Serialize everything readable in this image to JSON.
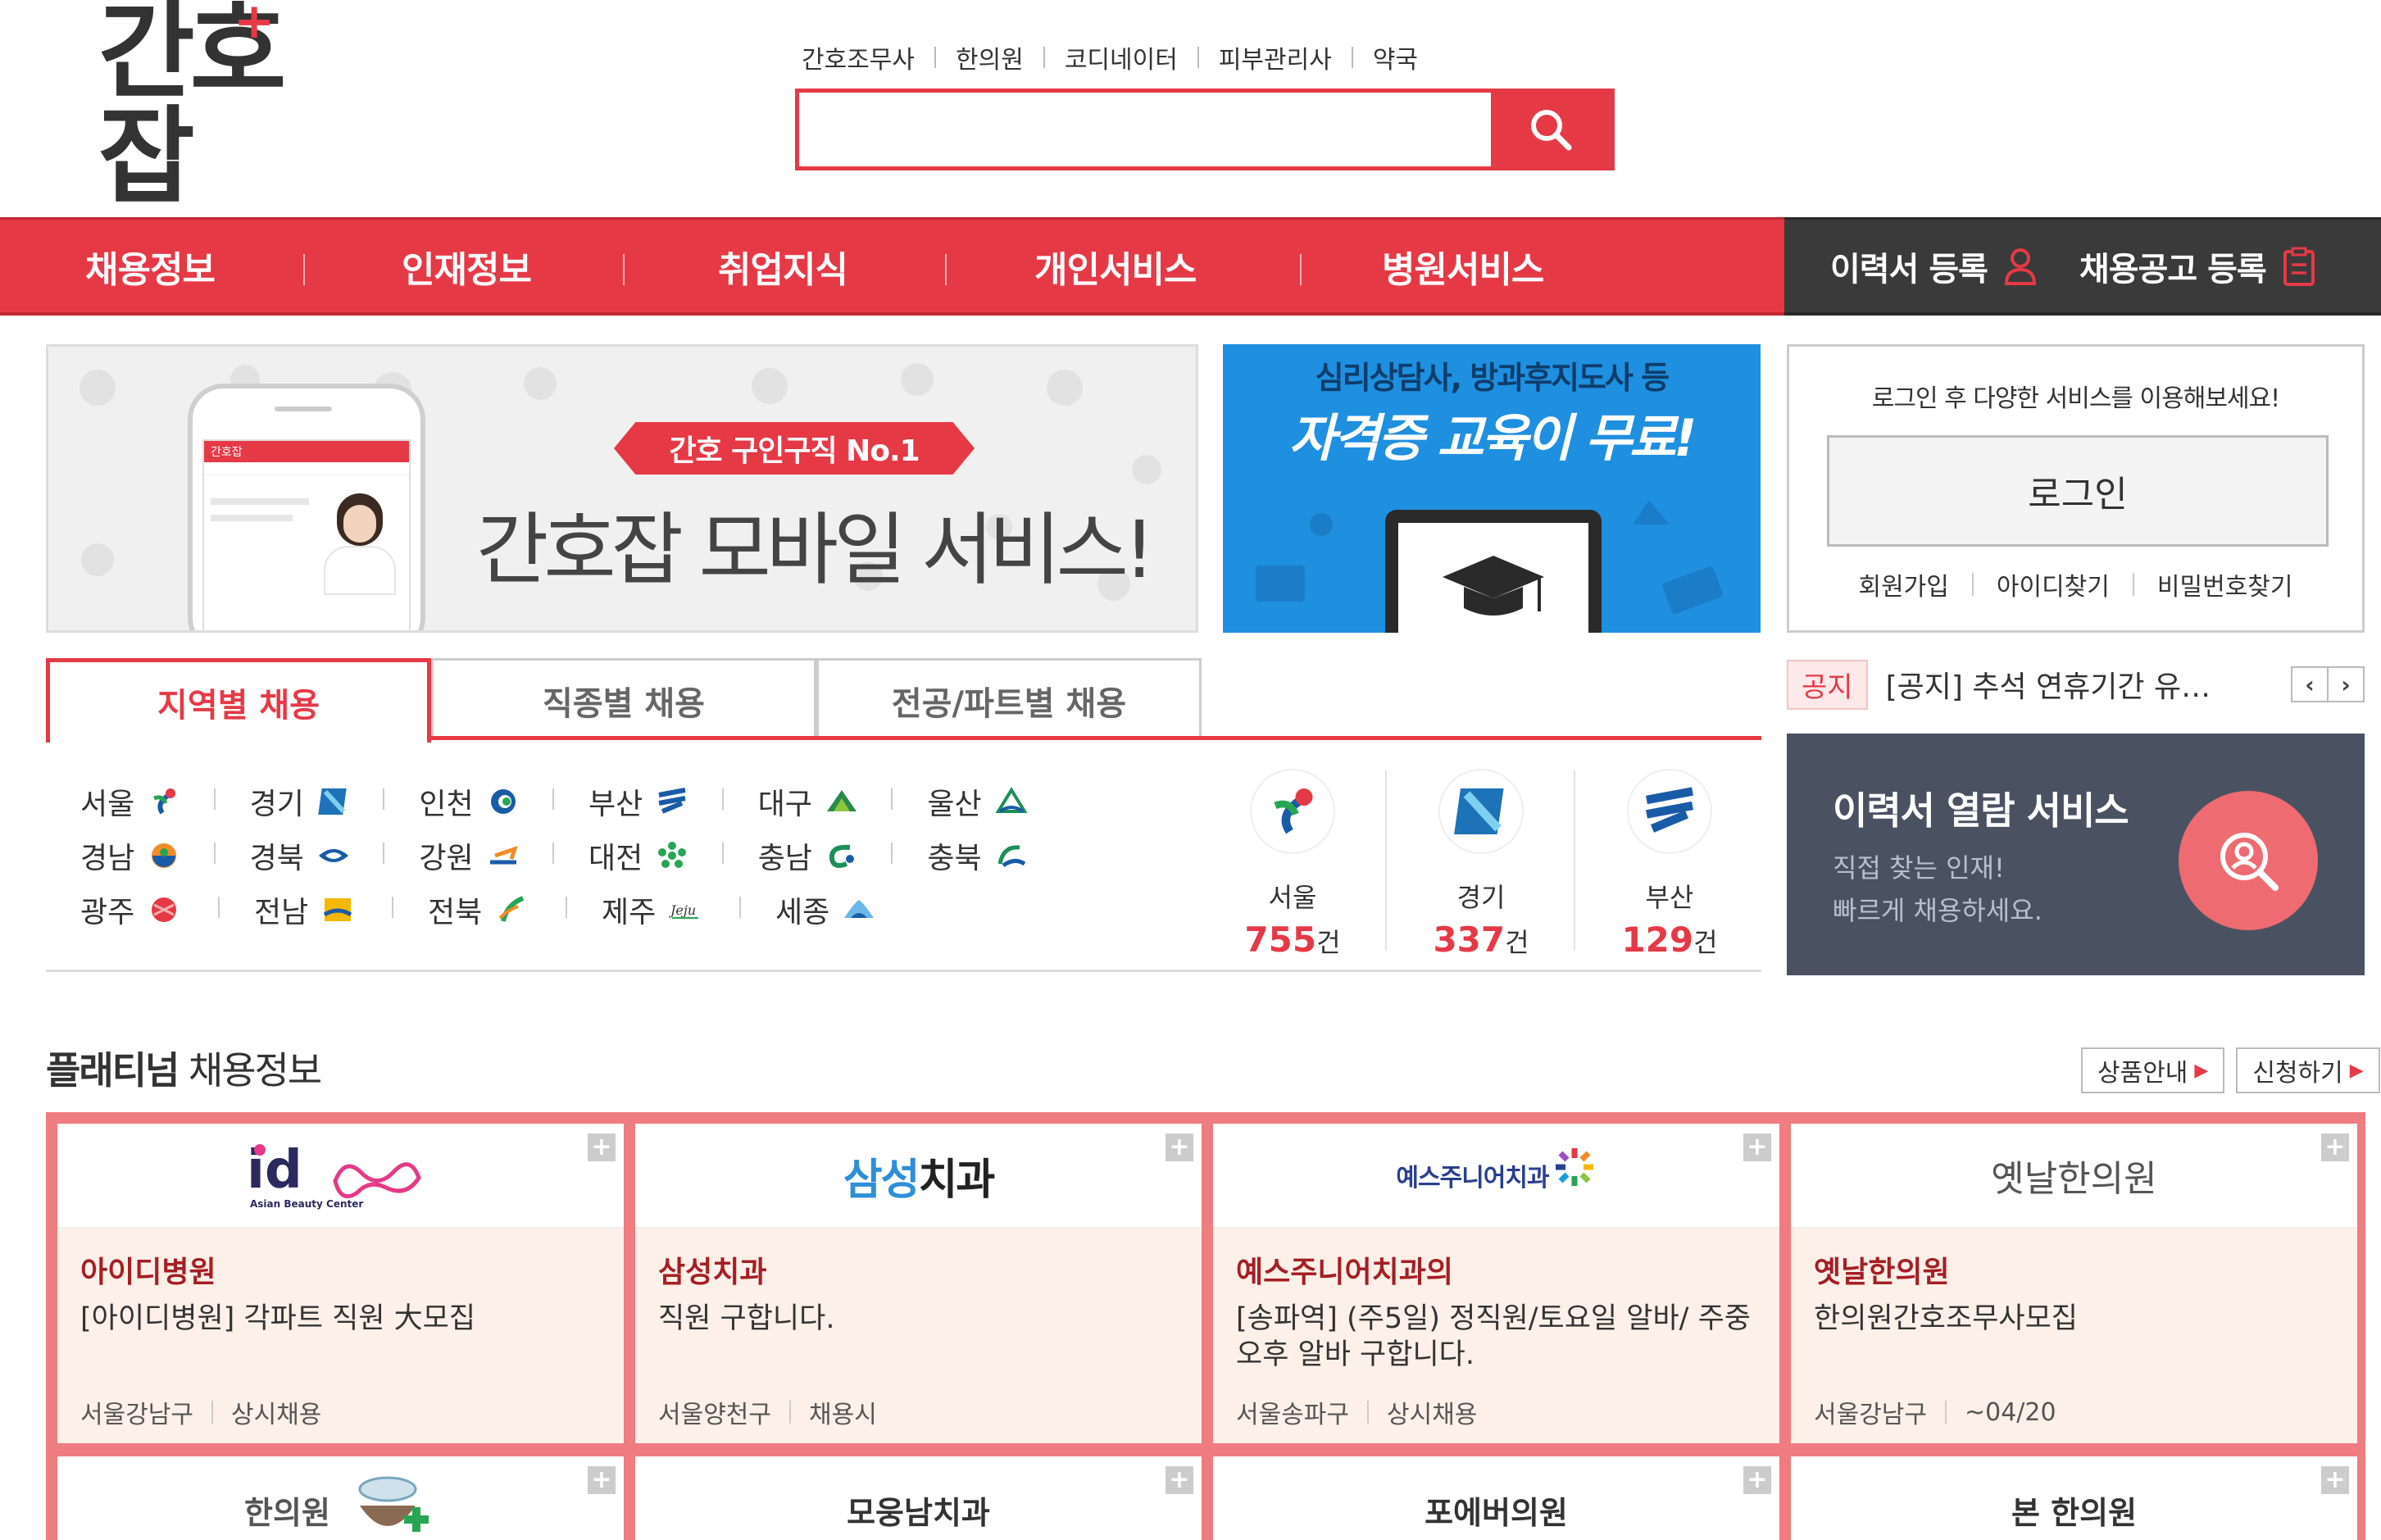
{
  "logo": {
    "text": "간호잡",
    "plus": "+"
  },
  "top_categories": [
    "간호조무사",
    "한의원",
    "코디네이터",
    "피부관리사",
    "약국"
  ],
  "search": {
    "value": "",
    "placeholder": ""
  },
  "nav": {
    "items": [
      "채용정보",
      "인재정보",
      "취업지식",
      "개인서비스",
      "병원서비스"
    ],
    "resume_register": "이력서 등록",
    "job_post_register": "채용공고 등록"
  },
  "banner1": {
    "ribbon": "간호 구인구직 No.1",
    "headline": "간호잡 모바일 서비스!",
    "phone_title": "간호잡"
  },
  "banner2": {
    "line1": "심리상담사, 방과후지도사 등",
    "line2": "자격증 교육이 무료!"
  },
  "login": {
    "message": "로그인 후 다양한 서비스를 이용해보세요!",
    "button": "로그인",
    "links": [
      "회원가입",
      "아이디찾기",
      "비밀번호찾기"
    ]
  },
  "tabs": [
    "지역별 채용",
    "직종별 채용",
    "전공/파트별 채용"
  ],
  "regions": [
    [
      "서울",
      "경기",
      "인천",
      "부산",
      "대구",
      "울산"
    ],
    [
      "경남",
      "경북",
      "강원",
      "대전",
      "충남",
      "충북"
    ],
    [
      "광주",
      "전남",
      "전북",
      "제주",
      "세종"
    ]
  ],
  "region_stats": [
    {
      "city": "서울",
      "count": "755",
      "unit": "건"
    },
    {
      "city": "경기",
      "count": "337",
      "unit": "건"
    },
    {
      "city": "부산",
      "count": "129",
      "unit": "건"
    }
  ],
  "notice": {
    "label": "공지",
    "text": "[공지] 추석 연휴기간 유…",
    "prev": "‹",
    "next": "›"
  },
  "service": {
    "title": "이력서 열람 서비스",
    "sub1": "직접 찾는 인재!",
    "sub2": "빠르게 채용하세요."
  },
  "platinum": {
    "title_bold": "플래티넘",
    "title_rest": " 채용정보",
    "product_guide": "상품안내",
    "apply": "신청하기",
    "cards": [
      {
        "logo_text": "id",
        "logo_sub": "Asian Beauty Center",
        "name": "아이디병원",
        "desc": "[아이디병원] 각파트 직원 大모집",
        "region": "서울강남구",
        "period": "상시채용"
      },
      {
        "logo_text": "삼성치과",
        "logo_a": "삼성",
        "logo_b": "치과",
        "name": "삼성치과",
        "desc": "직원 구합니다.",
        "region": "서울양천구",
        "period": "채용시"
      },
      {
        "logo_text": "예스주니어치과",
        "name": "예스주니어치과의",
        "desc": "[송파역] (주5일) 정직원/토요일 알바/ 주중오후 알바 구합니다.",
        "region": "서울송파구",
        "period": "상시채용"
      },
      {
        "logo_text": "옛날한의원",
        "name": "옛날한의원",
        "desc": "한의원간호조무사모집",
        "region": "서울강남구",
        "period": "~04/20"
      }
    ],
    "cards_row2": [
      "한의원",
      "모웅남치과",
      "포에버의원",
      "본 한의원"
    ]
  },
  "colors": {
    "accent": "#e63946",
    "dark": "#3a3a3a",
    "service_bg": "#4a5262",
    "card_body": "#fdf0e8",
    "grid_border": "#ef7c80",
    "banner2_bg": "#1f8fe0"
  }
}
